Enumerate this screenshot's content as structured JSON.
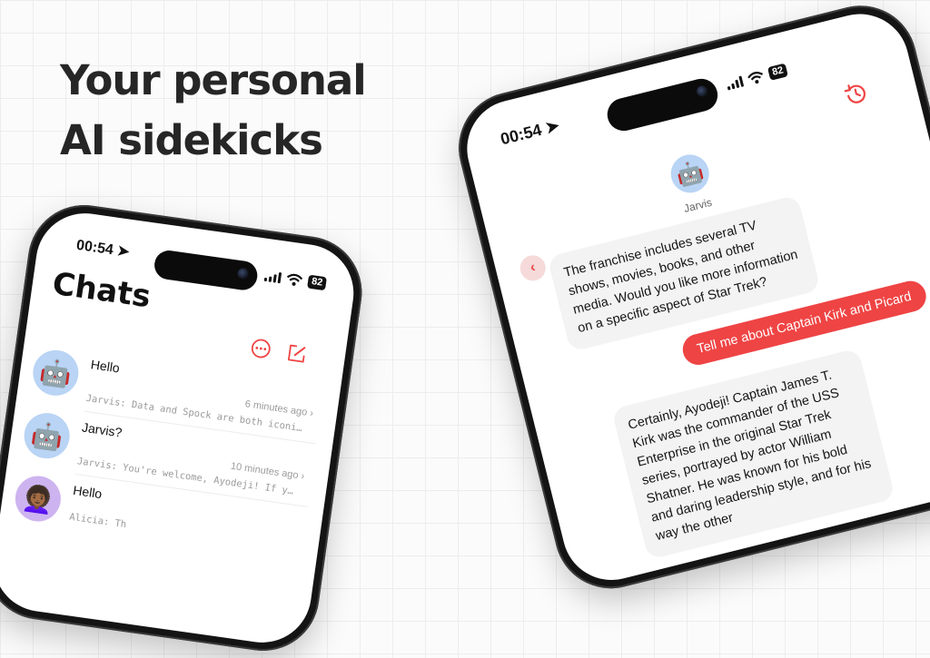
{
  "headline": {
    "line1": "Your personal",
    "line2": "AI sidekicks"
  },
  "colors": {
    "accent": "#ef4444",
    "text": "#262626",
    "bubble": "#f3f3f3"
  },
  "left_phone": {
    "status": {
      "time": "00:54",
      "battery": "82"
    },
    "title": "Chats",
    "header_icons": [
      "more-options-icon",
      "compose-icon"
    ],
    "chats": [
      {
        "name": "Hello",
        "time": "6 minutes ago",
        "preview": "Jarvis: Data and Spock are both iconic characters in t...",
        "avatar": "🤖"
      },
      {
        "name": "Jarvis?",
        "time": "10 minutes ago",
        "preview": "Jarvis: You're welcome, Ayodeji! If you need any assist...",
        "avatar": "🤖"
      },
      {
        "name": "Hello",
        "time": "",
        "preview": "Alicia: Th",
        "avatar": "👩🏾‍🦱"
      }
    ]
  },
  "right_phone": {
    "status": {
      "time": "00:54",
      "battery": "82"
    },
    "bot_name": "Jarvis",
    "bot_avatar": "🤖",
    "messages": {
      "first_in": "The franchise includes several TV shows, movies, books, and other media. Would you like more information on a specific aspect of Star Trek?",
      "user_out": "Tell me about Captain Kirk and Picard",
      "second_in": "Certainly, Ayodeji! Captain James T. Kirk was the commander of the USS Enterprise in the original Star Trek series, portrayed by actor William Shatner. He was known for his bold and daring leadership style, and for his way the other"
    }
  }
}
